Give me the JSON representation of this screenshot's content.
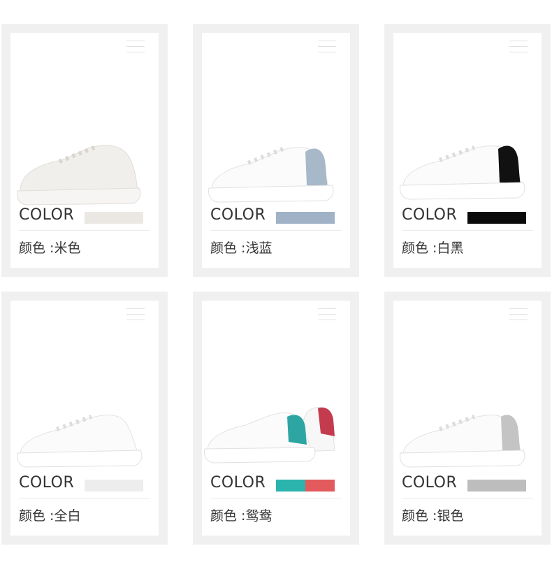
{
  "products": [
    {
      "color_label": "COLOR",
      "name": "颜色 :米色",
      "swatch": [
        "#ebe8e3"
      ],
      "shoe": "sneaker-plain-beige"
    },
    {
      "color_label": "COLOR",
      "name": "颜色 :浅蓝",
      "swatch": [
        "#9fb2c6"
      ],
      "shoe": "sneaker-lightblue-heel"
    },
    {
      "color_label": "COLOR",
      "name": "颜色 :白黑",
      "swatch": [
        "#0a0a0a"
      ],
      "shoe": "sneaker-black-heel"
    },
    {
      "color_label": "COLOR",
      "name": "颜色 :全白",
      "swatch": [
        "#ededed"
      ],
      "shoe": "sneaker-all-white"
    },
    {
      "color_label": "COLOR",
      "name": "颜色 :鸳鸯",
      "swatch": [
        "#2bb3ad",
        "#e35a5c"
      ],
      "shoe": "sneaker-teal-red-pair"
    },
    {
      "color_label": "COLOR",
      "name": "颜色 :银色",
      "swatch": [
        "#bdbdbd"
      ],
      "shoe": "sneaker-silver-heel"
    }
  ]
}
